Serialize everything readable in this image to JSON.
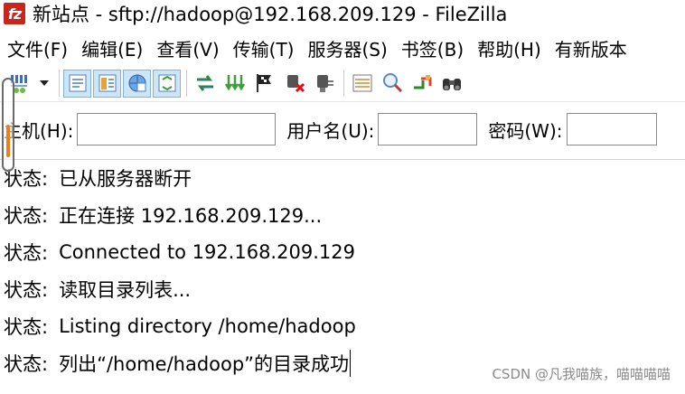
{
  "window": {
    "title": "新站点 - sftp://hadoop@192.168.209.129 - FileZilla",
    "logo_text": "fz"
  },
  "menu": {
    "items": [
      "文件(F)",
      "编辑(E)",
      "查看(V)",
      "传输(T)",
      "服务器(S)",
      "书签(B)",
      "帮助(H)",
      "有新版本"
    ]
  },
  "toolbar": {
    "buttons": [
      "site-manager-icon",
      "dropdown-arrow-icon",
      "toggle-log-icon",
      "toggle-local-tree-icon",
      "toggle-remote-tree-icon",
      "toggle-queue-icon",
      "refresh-icon",
      "process-queue-icon",
      "cancel-icon",
      "disconnect-icon",
      "reconnect-icon",
      "directory-listing-filters-icon",
      "toggle-sync-browsing-icon",
      "directory-comparison-icon",
      "search-remote-icon"
    ]
  },
  "quickconnect": {
    "host_label": "主机(H):",
    "username_label": "用户名(U):",
    "password_label": "密码(W):"
  },
  "log": {
    "status_label": "状态:",
    "lines": [
      "已从服务器断开",
      "正在连接 192.168.209.129...",
      "Connected to 192.168.209.129",
      "读取目录列表...",
      "Listing directory /home/hadoop",
      "列出“/home/hadoop”的目录成功"
    ]
  },
  "watermark": "CSDN @凡我喵族，喵喵喵喵",
  "colors": {
    "logo_red": "#c8261d",
    "accent_orange": "#f07c1a",
    "toolbar_active": "#cde6f7"
  }
}
